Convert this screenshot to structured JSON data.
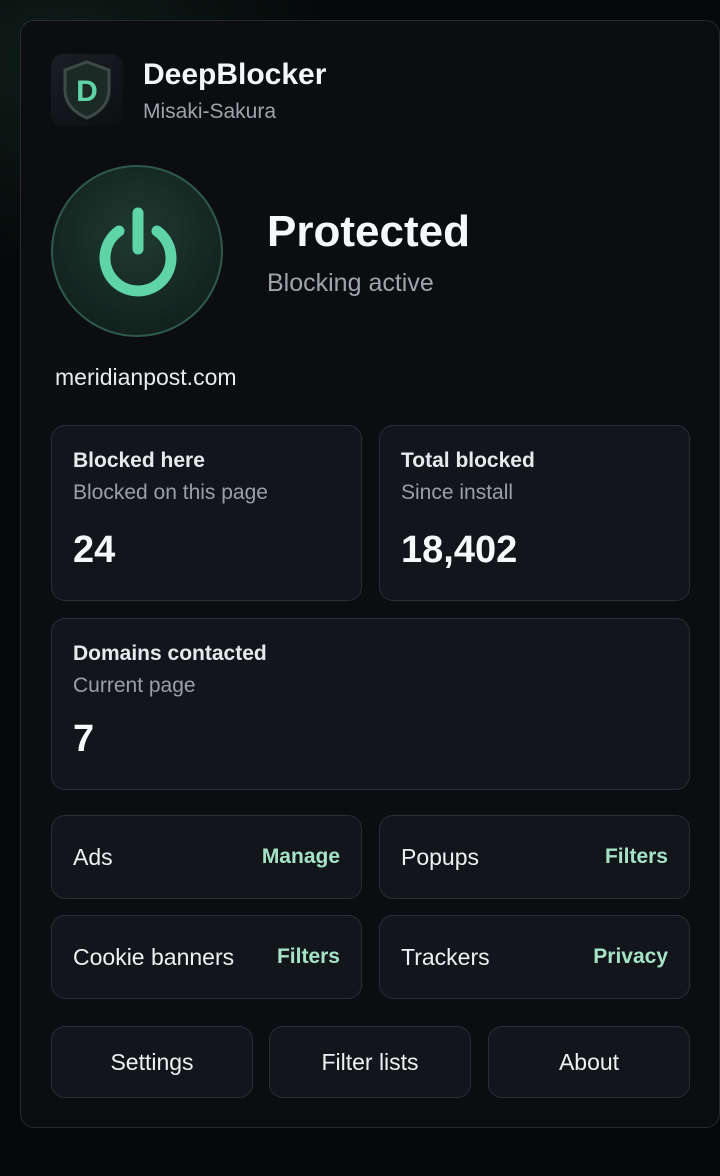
{
  "app": {
    "title": "DeepBlocker",
    "subtitle": "Misaki-Sakura",
    "logo_letter": "D"
  },
  "status": {
    "title": "Protected",
    "subtitle": "Blocking active"
  },
  "site": {
    "domain": "meridianpost.com"
  },
  "stats": [
    {
      "title": "Blocked here",
      "subtitle": "Blocked on this page",
      "value": "24"
    },
    {
      "title": "Total blocked",
      "subtitle": "Since install",
      "value": "18,402"
    },
    {
      "title": "Domains contacted",
      "subtitle": "Current page",
      "value": "7"
    }
  ],
  "categories": [
    {
      "label": "Ads",
      "action": "Manage"
    },
    {
      "label": "Popups",
      "action": "Filters"
    },
    {
      "label": "Cookie banners",
      "action": "Filters"
    },
    {
      "label": "Trackers",
      "action": "Privacy"
    }
  ],
  "footer": {
    "settings": "Settings",
    "filter_lists": "Filter lists",
    "about": "About"
  },
  "icons": {
    "logo": "shield-icon",
    "power": "power-icon"
  },
  "colors": {
    "accent": "#5fd4a6",
    "link": "#a6e3c6",
    "background": "#0b0d10"
  }
}
